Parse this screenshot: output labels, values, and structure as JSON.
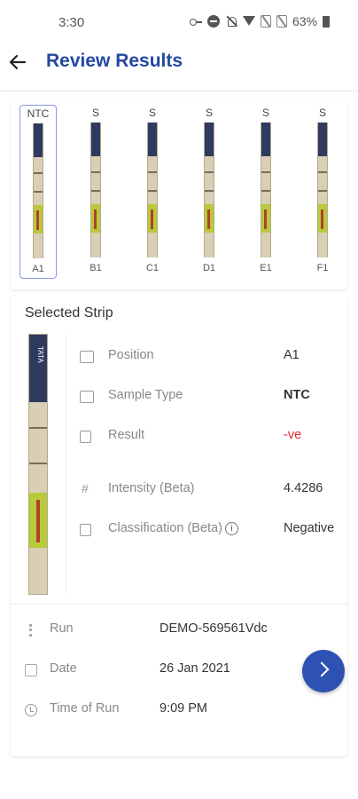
{
  "status_bar": {
    "time": "3:30",
    "battery": "63%",
    "icons": [
      "key-icon",
      "dnd-icon",
      "bell-off-icon",
      "wifi-icon",
      "no-sim-icon",
      "no-sim-icon",
      "battery-icon"
    ]
  },
  "header": {
    "title": "Review Results",
    "back_icon": "arrow-left-icon",
    "title_color": "#2448a0"
  },
  "strips": [
    {
      "type": "NTC",
      "position": "A1",
      "selected": true
    },
    {
      "type": "S",
      "position": "B1",
      "selected": false
    },
    {
      "type": "S",
      "position": "C1",
      "selected": false
    },
    {
      "type": "S",
      "position": "D1",
      "selected": false
    },
    {
      "type": "S",
      "position": "E1",
      "selected": false
    },
    {
      "type": "S",
      "position": "F1",
      "selected": false
    }
  ],
  "selected_strip": {
    "title": "Selected Strip",
    "strip_label": "TATA",
    "details": {
      "position": {
        "label": "Position",
        "value": "A1",
        "icon": "position-icon"
      },
      "sample_type": {
        "label": "Sample Type",
        "value": "NTC",
        "icon": "sample-type-icon"
      },
      "result": {
        "label": "Result",
        "value": "-ve",
        "icon": "result-icon",
        "color": "#e5252a"
      },
      "intensity": {
        "label": "Intensity (Beta)",
        "value": "4.4286",
        "icon": "hash-icon"
      },
      "classification": {
        "label": "Classification (Beta)",
        "value": "Negative",
        "icon": "classification-icon",
        "info_icon": "info-icon"
      }
    }
  },
  "run_info": {
    "run": {
      "label": "Run",
      "value": "DEMO-569561Vdc",
      "icon": "run-icon"
    },
    "date": {
      "label": "Date",
      "value": "26 Jan 2021",
      "icon": "calendar-icon"
    },
    "time": {
      "label": "Time of Run",
      "value": "9:09 PM",
      "icon": "clock-icon"
    }
  },
  "next_button": {
    "icon": "chevron-right-icon",
    "color": "#2e52b4"
  }
}
